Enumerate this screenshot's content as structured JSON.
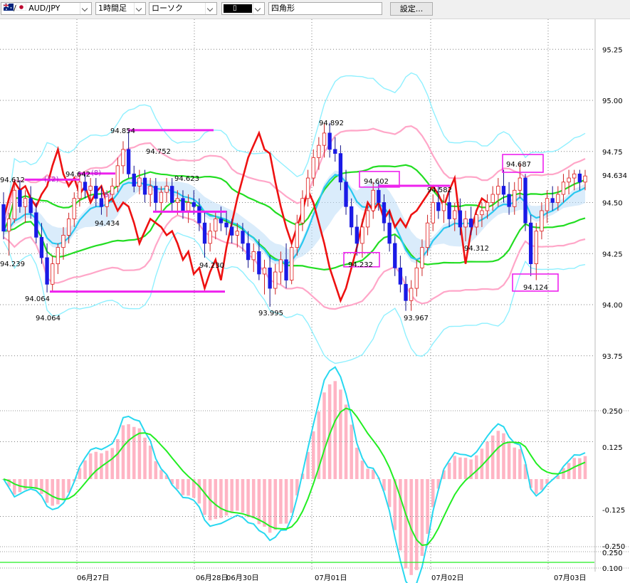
{
  "toolbar": {
    "symbol_separator": "/",
    "symbol": "AUD/JPY",
    "timeframe": "1時間足",
    "chart_style": "ローソク",
    "draw_color_label": "",
    "draw_shape": "四角形",
    "settings_button": "設定..."
  },
  "colors": {
    "bull_candle": "#ffffff",
    "bull_candle_border": "#e01818",
    "bear_candle": "#1a1ae6",
    "bb_outer": "#8ff0ff",
    "bb_inner": "#ffa6c8",
    "ema": "#28c8f0",
    "green_line": "#22dd22",
    "red_line": "#ee1111",
    "cloud_pink": "#ffc4dc",
    "cloud_blue": "#bcdcf8",
    "marker": "#ee22ee",
    "macd_signal": "#22ee22",
    "macd_line": "#28d8f0",
    "macd_hist": "#ffb4c4"
  },
  "chart_data": {
    "type": "candlestick",
    "price_axis": {
      "ticks": [
        "95.25",
        "95.00",
        "94.75",
        "94.50",
        "94.25",
        "94.00",
        "93.75"
      ],
      "current_price": "94.634"
    },
    "oscillator_axis": {
      "ticks": [
        "0.250",
        "0.125",
        "-0.125",
        "-0.250",
        "0.250",
        "0.100"
      ]
    },
    "x_labels": [
      "06月27日",
      "06月28日",
      "06月30日",
      "07月01日",
      "07月02日",
      "07月03日"
    ],
    "price_labels": [
      {
        "text": "94.854",
        "price": 94.854
      },
      {
        "text": "94.892",
        "price": 94.892
      },
      {
        "text": "94.752",
        "price": 94.752
      },
      {
        "text": "94.642",
        "price": 94.642
      },
      {
        "text": "94.612",
        "price": 94.612
      },
      {
        "text": "94.623",
        "price": 94.623
      },
      {
        "text": "94.434",
        "price": 94.434
      },
      {
        "text": "94.239",
        "price": 94.239
      },
      {
        "text": "94.230",
        "price": 94.23
      },
      {
        "text": "94.064",
        "price": 94.064
      },
      {
        "text": "94.064",
        "price": 94.064
      },
      {
        "text": "93.995",
        "price": 93.995
      },
      {
        "text": "94.602",
        "price": 94.602
      },
      {
        "text": "94.582",
        "price": 94.582
      },
      {
        "text": "94.232",
        "price": 94.232
      },
      {
        "text": "94.312",
        "price": 94.312
      },
      {
        "text": "93.967",
        "price": 93.967
      },
      {
        "text": "94.687",
        "price": 94.687
      },
      {
        "text": "94.124",
        "price": 94.124
      }
    ],
    "count_labels": [
      "(12)",
      "(8)",
      "(8)"
    ],
    "candles": [
      {
        "o": 94.49,
        "h": 94.55,
        "l": 94.32,
        "c": 94.36
      },
      {
        "o": 94.36,
        "h": 94.45,
        "l": 94.24,
        "c": 94.42
      },
      {
        "o": 94.42,
        "h": 94.6,
        "l": 94.4,
        "c": 94.56
      },
      {
        "o": 94.56,
        "h": 94.61,
        "l": 94.45,
        "c": 94.48
      },
      {
        "o": 94.48,
        "h": 94.56,
        "l": 94.4,
        "c": 94.52
      },
      {
        "o": 94.52,
        "h": 94.58,
        "l": 94.42,
        "c": 94.45
      },
      {
        "o": 94.45,
        "h": 94.5,
        "l": 94.3,
        "c": 94.33
      },
      {
        "o": 94.33,
        "h": 94.4,
        "l": 94.2,
        "c": 94.23
      },
      {
        "o": 94.23,
        "h": 94.3,
        "l": 94.06,
        "c": 94.1
      },
      {
        "o": 94.1,
        "h": 94.24,
        "l": 94.06,
        "c": 94.2
      },
      {
        "o": 94.2,
        "h": 94.3,
        "l": 94.15,
        "c": 94.28
      },
      {
        "o": 94.28,
        "h": 94.38,
        "l": 94.22,
        "c": 94.34
      },
      {
        "o": 94.34,
        "h": 94.45,
        "l": 94.3,
        "c": 94.42
      },
      {
        "o": 94.42,
        "h": 94.55,
        "l": 94.38,
        "c": 94.52
      },
      {
        "o": 94.52,
        "h": 94.64,
        "l": 94.48,
        "c": 94.6
      },
      {
        "o": 94.6,
        "h": 94.64,
        "l": 94.52,
        "c": 94.56
      },
      {
        "o": 94.56,
        "h": 94.62,
        "l": 94.5,
        "c": 94.58
      },
      {
        "o": 94.58,
        "h": 94.62,
        "l": 94.48,
        "c": 94.52
      },
      {
        "o": 94.52,
        "h": 94.58,
        "l": 94.44,
        "c": 94.48
      },
      {
        "o": 94.48,
        "h": 94.56,
        "l": 94.43,
        "c": 94.54
      },
      {
        "o": 94.54,
        "h": 94.62,
        "l": 94.5,
        "c": 94.58
      },
      {
        "o": 94.58,
        "h": 94.72,
        "l": 94.55,
        "c": 94.68
      },
      {
        "o": 94.68,
        "h": 94.8,
        "l": 94.64,
        "c": 94.76
      },
      {
        "o": 94.76,
        "h": 94.85,
        "l": 94.62,
        "c": 94.64
      },
      {
        "o": 94.64,
        "h": 94.68,
        "l": 94.55,
        "c": 94.58
      },
      {
        "o": 94.58,
        "h": 94.66,
        "l": 94.54,
        "c": 94.62
      },
      {
        "o": 94.62,
        "h": 94.66,
        "l": 94.5,
        "c": 94.54
      },
      {
        "o": 94.54,
        "h": 94.62,
        "l": 94.48,
        "c": 94.58
      },
      {
        "o": 94.58,
        "h": 94.62,
        "l": 94.46,
        "c": 94.5
      },
      {
        "o": 94.5,
        "h": 94.58,
        "l": 94.44,
        "c": 94.55
      },
      {
        "o": 94.55,
        "h": 94.62,
        "l": 94.5,
        "c": 94.58
      },
      {
        "o": 94.58,
        "h": 94.62,
        "l": 94.46,
        "c": 94.5
      },
      {
        "o": 94.5,
        "h": 94.56,
        "l": 94.44,
        "c": 94.52
      },
      {
        "o": 94.52,
        "h": 94.56,
        "l": 94.42,
        "c": 94.46
      },
      {
        "o": 94.46,
        "h": 94.54,
        "l": 94.4,
        "c": 94.5
      },
      {
        "o": 94.5,
        "h": 94.56,
        "l": 94.44,
        "c": 94.48
      },
      {
        "o": 94.48,
        "h": 94.52,
        "l": 94.36,
        "c": 94.4
      },
      {
        "o": 94.4,
        "h": 94.46,
        "l": 94.23,
        "c": 94.3
      },
      {
        "o": 94.3,
        "h": 94.4,
        "l": 94.26,
        "c": 94.36
      },
      {
        "o": 94.36,
        "h": 94.46,
        "l": 94.32,
        "c": 94.42
      },
      {
        "o": 94.42,
        "h": 94.48,
        "l": 94.36,
        "c": 94.4
      },
      {
        "o": 94.4,
        "h": 94.46,
        "l": 94.34,
        "c": 94.38
      },
      {
        "o": 94.38,
        "h": 94.42,
        "l": 94.3,
        "c": 94.34
      },
      {
        "o": 94.34,
        "h": 94.4,
        "l": 94.28,
        "c": 94.36
      },
      {
        "o": 94.36,
        "h": 94.4,
        "l": 94.26,
        "c": 94.3
      },
      {
        "o": 94.3,
        "h": 94.36,
        "l": 94.18,
        "c": 94.22
      },
      {
        "o": 94.22,
        "h": 94.3,
        "l": 94.16,
        "c": 94.26
      },
      {
        "o": 94.26,
        "h": 94.32,
        "l": 94.12,
        "c": 94.15
      },
      {
        "o": 94.15,
        "h": 94.22,
        "l": 94.05,
        "c": 94.18
      },
      {
        "o": 94.18,
        "h": 94.24,
        "l": 93.99,
        "c": 94.08
      },
      {
        "o": 94.08,
        "h": 94.2,
        "l": 94.05,
        "c": 94.16
      },
      {
        "o": 94.16,
        "h": 94.26,
        "l": 94.1,
        "c": 94.22
      },
      {
        "o": 94.22,
        "h": 94.3,
        "l": 94.08,
        "c": 94.12
      },
      {
        "o": 94.12,
        "h": 94.3,
        "l": 94.1,
        "c": 94.28
      },
      {
        "o": 94.28,
        "h": 94.44,
        "l": 94.24,
        "c": 94.4
      },
      {
        "o": 94.4,
        "h": 94.56,
        "l": 94.36,
        "c": 94.52
      },
      {
        "o": 94.52,
        "h": 94.66,
        "l": 94.48,
        "c": 94.62
      },
      {
        "o": 94.62,
        "h": 94.76,
        "l": 94.58,
        "c": 94.72
      },
      {
        "o": 94.72,
        "h": 94.82,
        "l": 94.66,
        "c": 94.78
      },
      {
        "o": 94.78,
        "h": 94.89,
        "l": 94.72,
        "c": 94.84
      },
      {
        "o": 94.84,
        "h": 94.89,
        "l": 94.72,
        "c": 94.76
      },
      {
        "o": 94.76,
        "h": 94.82,
        "l": 94.7,
        "c": 94.74
      },
      {
        "o": 94.74,
        "h": 94.78,
        "l": 94.56,
        "c": 94.6
      },
      {
        "o": 94.6,
        "h": 94.66,
        "l": 94.44,
        "c": 94.48
      },
      {
        "o": 94.48,
        "h": 94.52,
        "l": 94.34,
        "c": 94.38
      },
      {
        "o": 94.38,
        "h": 94.44,
        "l": 94.24,
        "c": 94.3
      },
      {
        "o": 94.3,
        "h": 94.42,
        "l": 94.23,
        "c": 94.38
      },
      {
        "o": 94.38,
        "h": 94.5,
        "l": 94.34,
        "c": 94.46
      },
      {
        "o": 94.46,
        "h": 94.6,
        "l": 94.42,
        "c": 94.56
      },
      {
        "o": 94.56,
        "h": 94.6,
        "l": 94.46,
        "c": 94.5
      },
      {
        "o": 94.5,
        "h": 94.54,
        "l": 94.36,
        "c": 94.4
      },
      {
        "o": 94.4,
        "h": 94.46,
        "l": 94.26,
        "c": 94.3
      },
      {
        "o": 94.3,
        "h": 94.34,
        "l": 94.14,
        "c": 94.18
      },
      {
        "o": 94.18,
        "h": 94.24,
        "l": 94.06,
        "c": 94.1
      },
      {
        "o": 94.1,
        "h": 94.14,
        "l": 93.97,
        "c": 94.02
      },
      {
        "o": 94.02,
        "h": 94.12,
        "l": 93.97,
        "c": 94.08
      },
      {
        "o": 94.08,
        "h": 94.22,
        "l": 94.04,
        "c": 94.18
      },
      {
        "o": 94.18,
        "h": 94.32,
        "l": 94.14,
        "c": 94.28
      },
      {
        "o": 94.28,
        "h": 94.44,
        "l": 94.24,
        "c": 94.4
      },
      {
        "o": 94.4,
        "h": 94.54,
        "l": 94.36,
        "c": 94.5
      },
      {
        "o": 94.5,
        "h": 94.58,
        "l": 94.42,
        "c": 94.46
      },
      {
        "o": 94.46,
        "h": 94.54,
        "l": 94.4,
        "c": 94.5
      },
      {
        "o": 94.5,
        "h": 94.56,
        "l": 94.38,
        "c": 94.42
      },
      {
        "o": 94.42,
        "h": 94.5,
        "l": 94.36,
        "c": 94.46
      },
      {
        "o": 94.46,
        "h": 94.52,
        "l": 94.34,
        "c": 94.38
      },
      {
        "o": 94.38,
        "h": 94.46,
        "l": 94.31,
        "c": 94.42
      },
      {
        "o": 94.42,
        "h": 94.48,
        "l": 94.34,
        "c": 94.38
      },
      {
        "o": 94.38,
        "h": 94.46,
        "l": 94.34,
        "c": 94.44
      },
      {
        "o": 94.44,
        "h": 94.5,
        "l": 94.38,
        "c": 94.46
      },
      {
        "o": 94.46,
        "h": 94.54,
        "l": 94.42,
        "c": 94.5
      },
      {
        "o": 94.5,
        "h": 94.58,
        "l": 94.46,
        "c": 94.54
      },
      {
        "o": 94.54,
        "h": 94.62,
        "l": 94.48,
        "c": 94.58
      },
      {
        "o": 94.58,
        "h": 94.66,
        "l": 94.5,
        "c": 94.54
      },
      {
        "o": 94.54,
        "h": 94.6,
        "l": 94.44,
        "c": 94.48
      },
      {
        "o": 94.48,
        "h": 94.6,
        "l": 94.44,
        "c": 94.56
      },
      {
        "o": 94.56,
        "h": 94.69,
        "l": 94.52,
        "c": 94.62
      },
      {
        "o": 94.62,
        "h": 94.64,
        "l": 94.36,
        "c": 94.4
      },
      {
        "o": 94.4,
        "h": 94.44,
        "l": 94.14,
        "c": 94.2
      },
      {
        "o": 94.2,
        "h": 94.4,
        "l": 94.12,
        "c": 94.36
      },
      {
        "o": 94.36,
        "h": 94.5,
        "l": 94.32,
        "c": 94.46
      },
      {
        "o": 94.46,
        "h": 94.56,
        "l": 94.4,
        "c": 94.52
      },
      {
        "o": 94.52,
        "h": 94.58,
        "l": 94.46,
        "c": 94.5
      },
      {
        "o": 94.5,
        "h": 94.58,
        "l": 94.46,
        "c": 94.54
      },
      {
        "o": 94.54,
        "h": 94.64,
        "l": 94.5,
        "c": 94.6
      },
      {
        "o": 94.6,
        "h": 94.66,
        "l": 94.54,
        "c": 94.62
      },
      {
        "o": 94.62,
        "h": 94.66,
        "l": 94.56,
        "c": 94.64
      },
      {
        "o": 94.64,
        "h": 94.66,
        "l": 94.56,
        "c": 94.6
      },
      {
        "o": 94.6,
        "h": 94.66,
        "l": 94.56,
        "c": 94.63
      }
    ]
  }
}
